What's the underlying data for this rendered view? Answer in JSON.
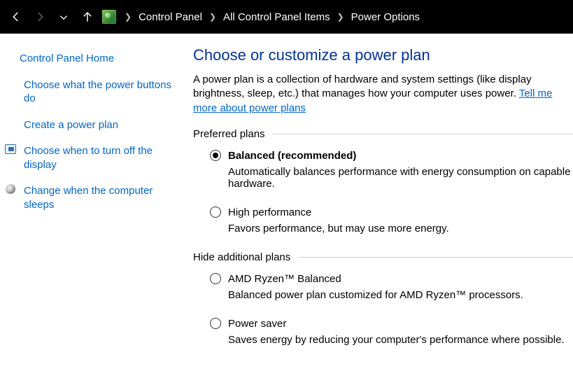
{
  "breadcrumb": {
    "items": [
      "Control Panel",
      "All Control Panel Items",
      "Power Options"
    ]
  },
  "sidebar": {
    "home": "Control Panel Home",
    "links": [
      {
        "label": "Choose what the power buttons do",
        "icon": null
      },
      {
        "label": "Create a power plan",
        "icon": null
      },
      {
        "label": "Choose when to turn off the display",
        "icon": "monitor"
      },
      {
        "label": "Change when the computer sleeps",
        "icon": "moon"
      }
    ]
  },
  "main": {
    "heading": "Choose or customize a power plan",
    "intro_pre": "A power plan is a collection of hardware and system settings (like display brightness, sleep, etc.) that manages how your computer uses power. ",
    "intro_link": "Tell me more about power plans",
    "group1_label": "Preferred plans",
    "group2_label": "Hide additional plans",
    "plans_preferred": [
      {
        "name": "Balanced (recommended)",
        "selected": true,
        "desc": "Automatically balances performance with energy consumption on capable hardware."
      },
      {
        "name": "High performance",
        "selected": false,
        "desc": "Favors performance, but may use more energy."
      }
    ],
    "plans_additional": [
      {
        "name": "AMD Ryzen™ Balanced",
        "selected": false,
        "desc": "Balanced power plan customized for AMD Ryzen™ processors."
      },
      {
        "name": "Power saver",
        "selected": false,
        "desc": "Saves energy by reducing your computer's performance where possible."
      }
    ]
  }
}
